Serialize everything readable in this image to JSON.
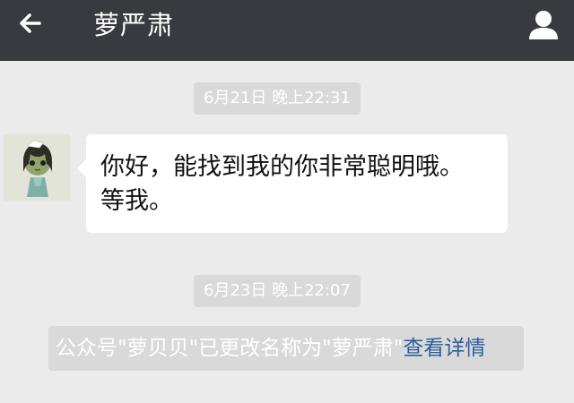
{
  "header": {
    "title": "萝严肃",
    "back_icon": "back-arrow-icon",
    "profile_icon": "person-icon",
    "background": "#393a3f"
  },
  "messages": [
    {
      "timestamp": "6月21日 晚上22:31",
      "lines": [
        "你好，能找到我的你非常聪明哦。",
        "等我。"
      ]
    }
  ],
  "system": {
    "timestamp": "6月23日 晚上22:07",
    "notice_text": "公众号\"萝贝贝\"已更改名称为\"萝严肃\"",
    "link_text": "查看详情",
    "link_color": "#2b5e9e"
  }
}
